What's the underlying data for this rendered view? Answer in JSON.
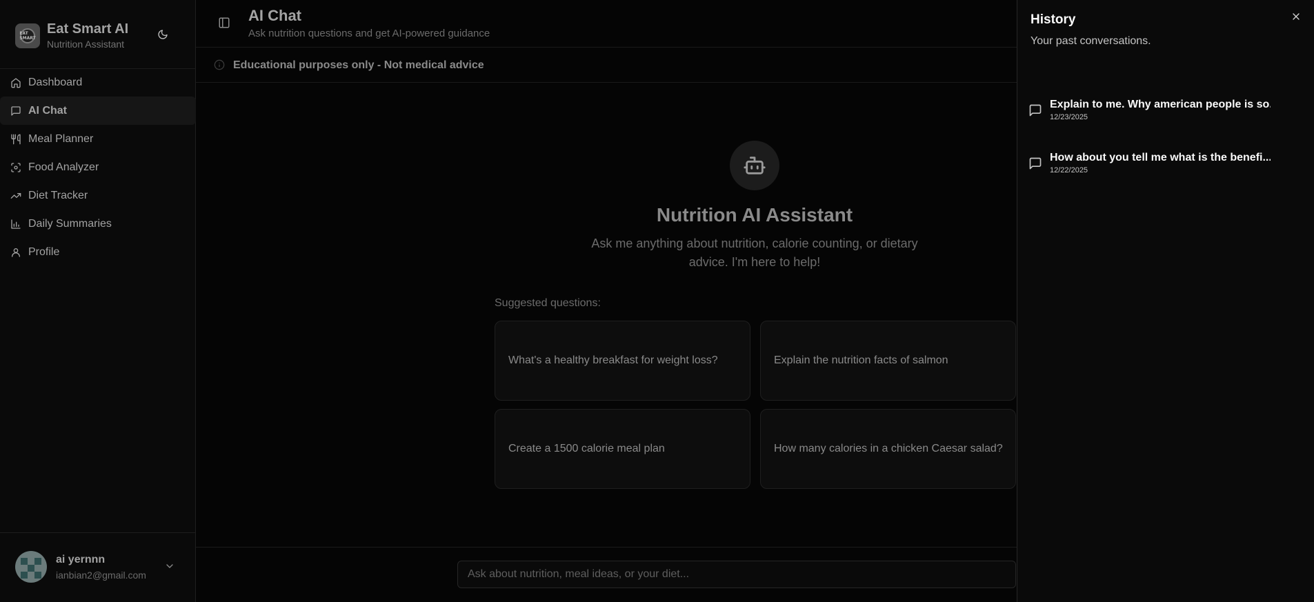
{
  "brand": {
    "title": "Eat Smart AI",
    "subtitle": "Nutrition Assistant",
    "logo_text": "EAT SMART"
  },
  "sidebar": {
    "items": [
      {
        "label": "Dashboard",
        "icon": "home-icon"
      },
      {
        "label": "AI Chat",
        "icon": "message-square-icon",
        "active": true
      },
      {
        "label": "Meal Planner",
        "icon": "utensils-icon"
      },
      {
        "label": "Food Analyzer",
        "icon": "scan-icon"
      },
      {
        "label": "Diet Tracker",
        "icon": "trending-up-icon"
      },
      {
        "label": "Daily Summaries",
        "icon": "bar-chart-icon"
      },
      {
        "label": "Profile",
        "icon": "user-icon"
      }
    ]
  },
  "user": {
    "name": "ai yernnn",
    "email": "ianbian2@gmail.com"
  },
  "header": {
    "title": "AI Chat",
    "subtitle": "Ask nutrition questions and get AI-powered guidance"
  },
  "notice": {
    "text": "Educational purposes only - Not medical advice"
  },
  "empty_state": {
    "title": "Nutrition AI Assistant",
    "description": "Ask me anything about nutrition, calorie counting, or dietary advice. I'm here to help!",
    "suggestions_label": "Suggested questions:",
    "suggestions": [
      "What's a healthy breakfast for weight loss?",
      "Explain the nutrition facts of salmon",
      "Create a 1500 calorie meal plan",
      "How many calories in a chicken Caesar salad?"
    ]
  },
  "composer": {
    "placeholder": "Ask about nutrition, meal ideas, or your diet..."
  },
  "history": {
    "title": "History",
    "subtitle": "Your past conversations.",
    "items": [
      {
        "title": "Explain to me. Why american people is so...",
        "date": "12/23/2025"
      },
      {
        "title": "How about you tell me what is the benefi...",
        "date": "12/22/2025"
      }
    ]
  },
  "colors": {
    "background": "#000000",
    "sidebar": "#0a0a0a",
    "text_muted": "#a3a3a3",
    "drawer_text": "#fafafa"
  }
}
